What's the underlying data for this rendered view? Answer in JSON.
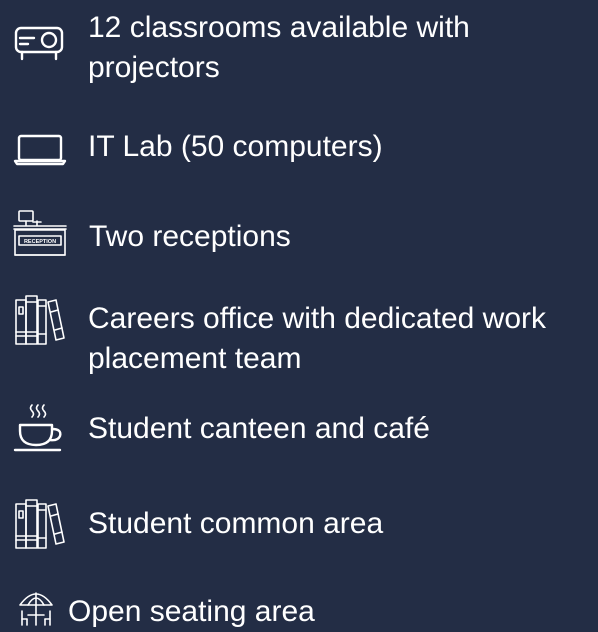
{
  "colors": {
    "background": "#232d45",
    "text": "#ffffff"
  },
  "facilities": [
    {
      "icon": "projector-icon",
      "lines": [
        "12 classrooms available with",
        "projectors"
      ]
    },
    {
      "icon": "laptop-icon",
      "lines": [
        "IT Lab (50 computers)"
      ]
    },
    {
      "icon": "reception-desk-icon",
      "icon_text": "RECEPTION",
      "lines": [
        "Two receptions"
      ]
    },
    {
      "icon": "books-icon",
      "lines": [
        "Careers office with dedicated work",
        "placement team"
      ]
    },
    {
      "icon": "coffee-cup-icon",
      "lines": [
        "Student canteen and café"
      ]
    },
    {
      "icon": "books-icon",
      "lines": [
        "Student common area"
      ]
    },
    {
      "icon": "umbrella-table-icon",
      "lines": [
        "Open seating area"
      ]
    }
  ]
}
